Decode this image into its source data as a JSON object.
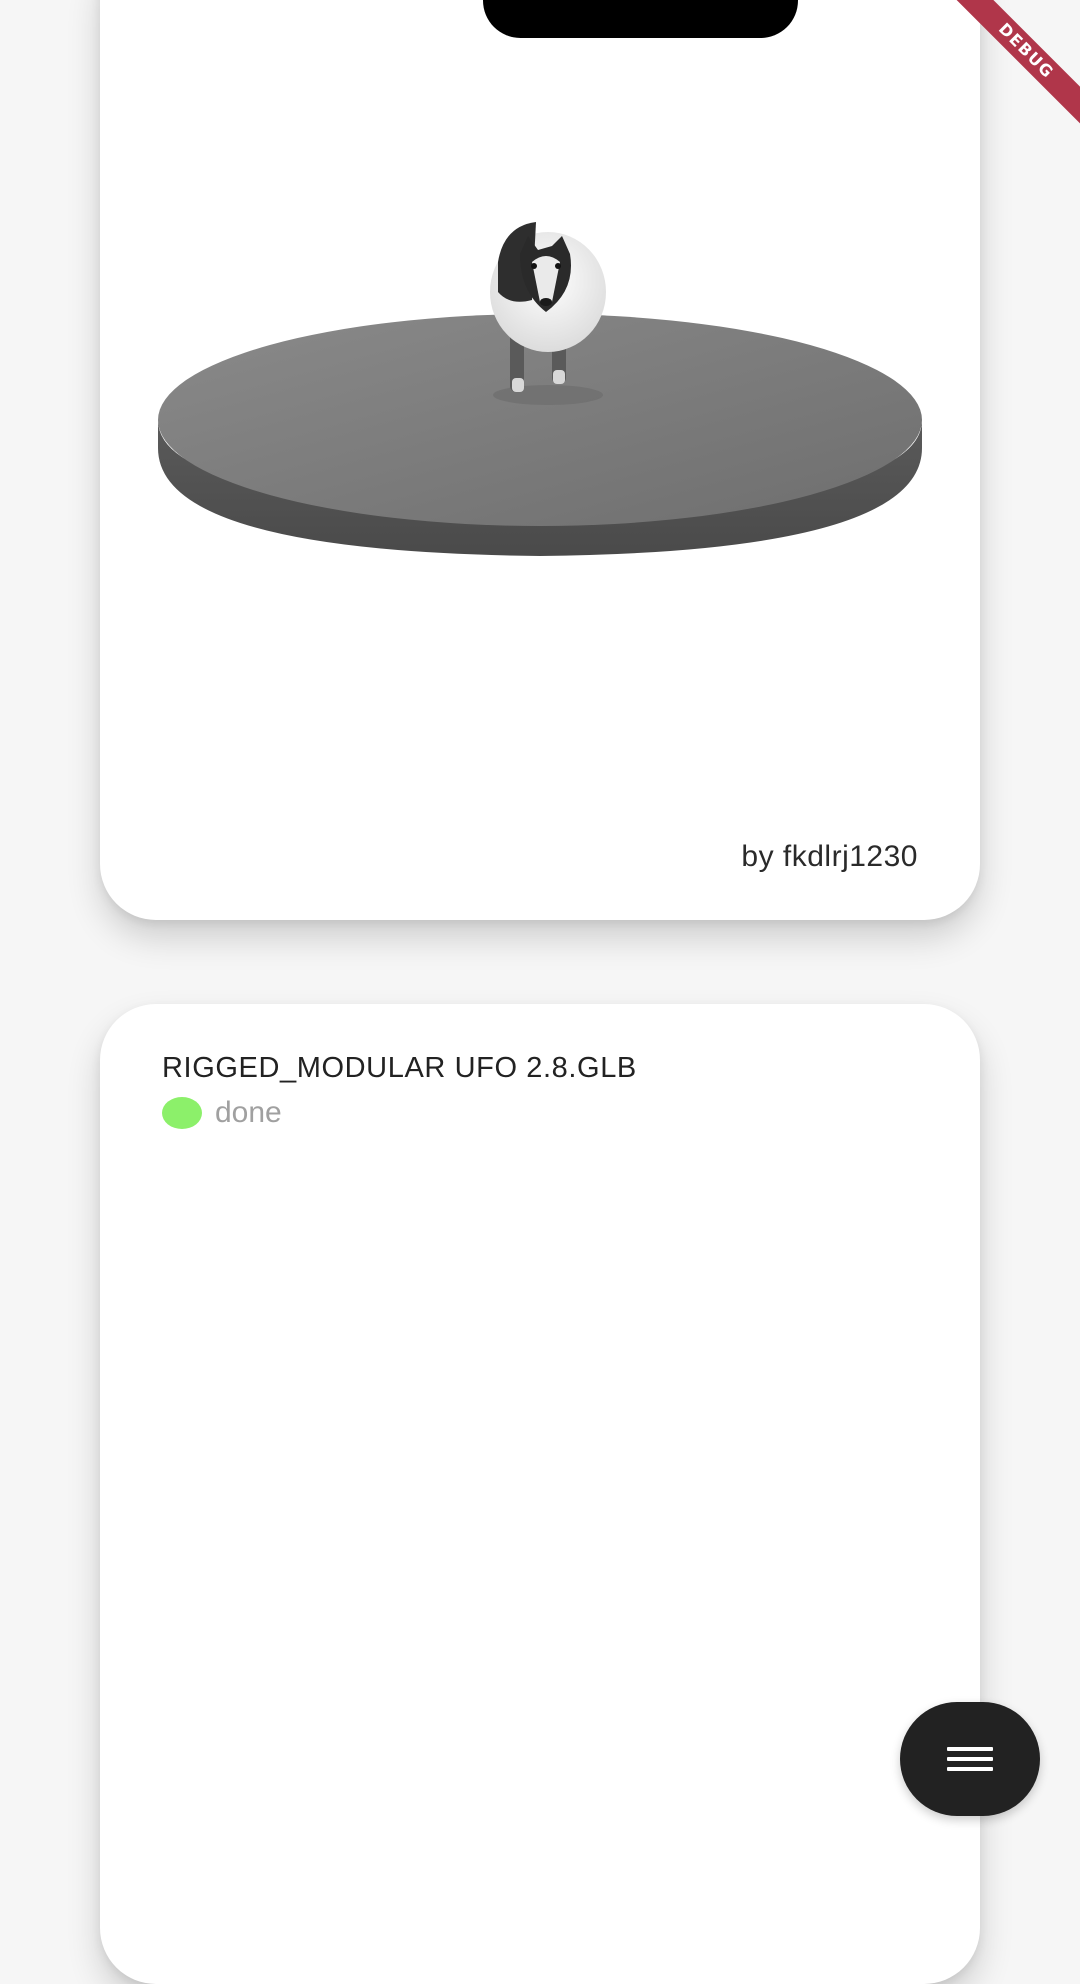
{
  "debug_banner": {
    "label": "DEBUG",
    "color": "#b0364a"
  },
  "cards": [
    {
      "author_label": "by fkdlrj1230",
      "preview": "3d-model-preview"
    },
    {
      "title": "RIGGED_MODULAR UFO 2.8.GLB",
      "status": {
        "text": "done",
        "color": "#8cf06a"
      }
    }
  ],
  "fab": {
    "icon": "menu-icon"
  },
  "colors": {
    "background": "#f6f6f6",
    "card": "#ffffff",
    "fab": "#222222"
  }
}
